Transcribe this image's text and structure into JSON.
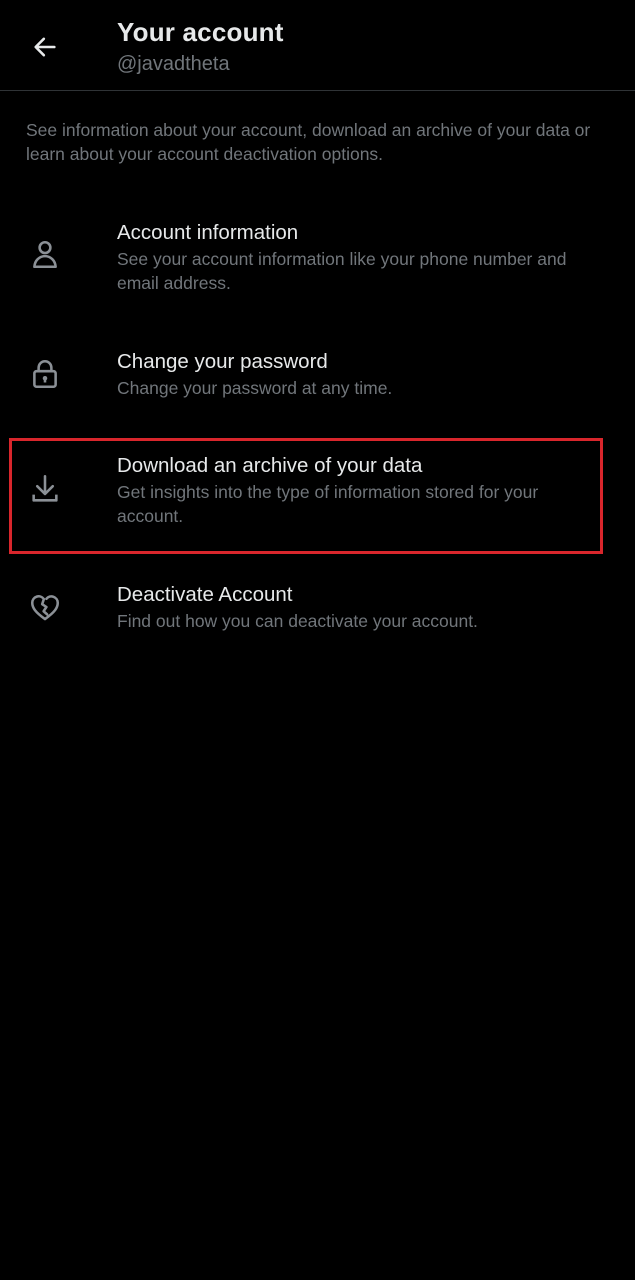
{
  "header": {
    "title": "Your account",
    "handle": "@javadtheta",
    "back_icon": "arrow-left-icon"
  },
  "intro_text": "See information about your account, download an archive of your data or learn about your account deactivation options.",
  "items": [
    {
      "label": "Account information",
      "description": "See your account information like your phone number and email address.",
      "icon": "person-icon"
    },
    {
      "label": "Change your password",
      "description": "Change your password at any time.",
      "icon": "lock-icon"
    },
    {
      "label": "Download an archive of your data",
      "description": "Get insights into the type of information stored for your account.",
      "icon": "download-icon"
    },
    {
      "label": "Deactivate Account",
      "description": "Find out how you can deactivate your account.",
      "icon": "broken-heart-icon"
    }
  ],
  "colors": {
    "background": "#000000",
    "primary_text": "#e7e9ea",
    "secondary_text": "#71767b",
    "divider": "#2f3336",
    "highlight": "#d9262c"
  }
}
